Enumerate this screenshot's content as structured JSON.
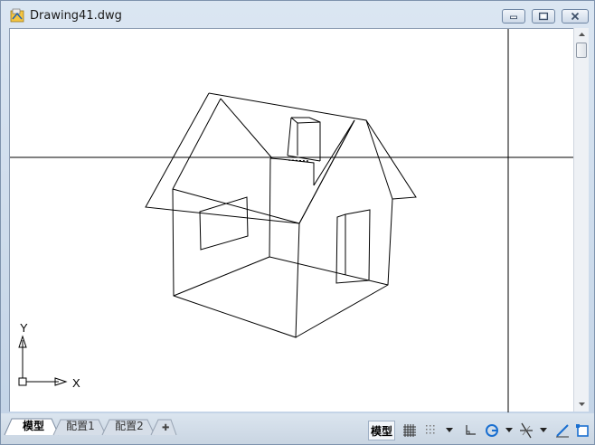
{
  "window": {
    "title": "Drawing41.dwg"
  },
  "canvas": {
    "ucs_y_label": "Y",
    "ucs_x_label": "X"
  },
  "tabs": [
    {
      "label": "模型",
      "active": true
    },
    {
      "label": "配置1",
      "active": false
    },
    {
      "label": "配置2",
      "active": false
    }
  ],
  "statusbar": {
    "model_label": "模型",
    "icons": [
      "grid-icon",
      "snap-icon",
      "dropdown-arrow",
      "ortho-icon",
      "polar-icon",
      "dropdown-arrow",
      "osnap-icon",
      "dropdown-arrow",
      "isodraft-icon",
      "workspace-icon"
    ]
  }
}
